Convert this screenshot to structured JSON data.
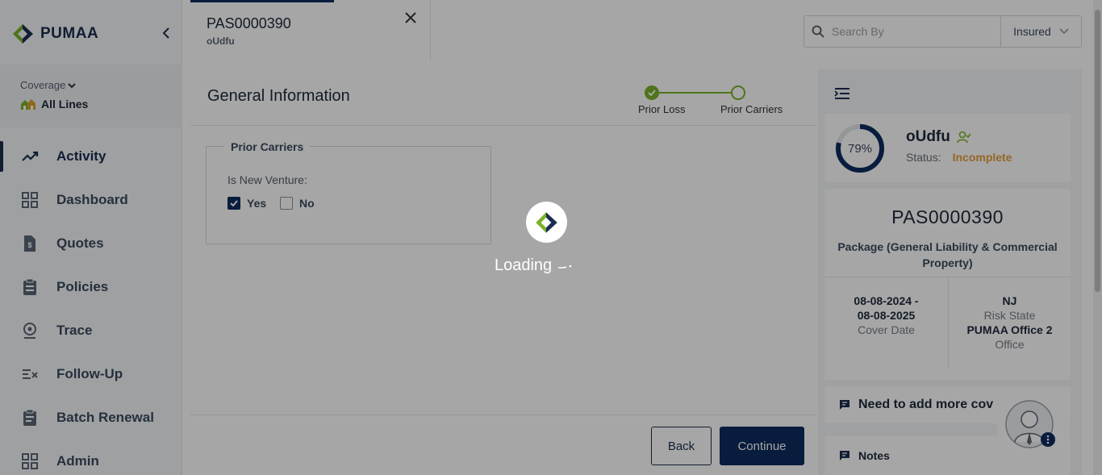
{
  "app": {
    "logo_text": "PUMAA"
  },
  "sidebar": {
    "coverage_label": "Coverage",
    "coverage_value": "All Lines",
    "items": [
      {
        "label": "Activity",
        "icon": "trending-up-icon",
        "active": true
      },
      {
        "label": "Dashboard",
        "icon": "grid-icon"
      },
      {
        "label": "Quotes",
        "icon": "quote-document-icon"
      },
      {
        "label": "Policies",
        "icon": "clipboard-icon"
      },
      {
        "label": "Trace",
        "icon": "location-pin-icon"
      },
      {
        "label": "Follow-Up",
        "icon": "checklist-icon"
      },
      {
        "label": "Batch Renewal",
        "icon": "clipboard-list-icon"
      },
      {
        "label": "Admin",
        "icon": "admin-grid-icon"
      }
    ]
  },
  "tab": {
    "title": "PAS0000390",
    "subtitle": "oUdfu"
  },
  "search": {
    "placeholder": "Search By",
    "filter_value": "Insured"
  },
  "main": {
    "title": "General Information",
    "steps": [
      {
        "label": "Prior Loss",
        "state": "complete"
      },
      {
        "label": "Prior Carriers",
        "state": "current"
      }
    ],
    "section_title": "Prior Carriers",
    "new_venture_label": "Is New Venture:",
    "options": [
      {
        "label": "Yes",
        "checked": true
      },
      {
        "label": "No",
        "checked": false
      }
    ],
    "back_label": "Back",
    "continue_label": "Continue"
  },
  "summary": {
    "completion_percent": 79,
    "completion_label": "79%",
    "insured_name": "oUdfu",
    "status_label": "Status:",
    "status_value": "Incomplete",
    "policy_number": "PAS0000390",
    "policy_type": "Package (General Liability & Commercial Property)",
    "cover_date_start": "08-08-2024 -",
    "cover_date_end": "08-08-2025",
    "cover_date_label": "Cover Date",
    "risk_state": "NJ",
    "risk_state_label": "Risk State",
    "office_value": "PUMAA Office 2",
    "office_label": "Office",
    "need_more_text": "Need to add more cov",
    "notes_label": "Notes"
  },
  "colors": {
    "primary": "#0d2b5e",
    "accent": "#7ab32a",
    "status_warning": "#e4a03c"
  },
  "loading": {
    "text": "Loading"
  }
}
